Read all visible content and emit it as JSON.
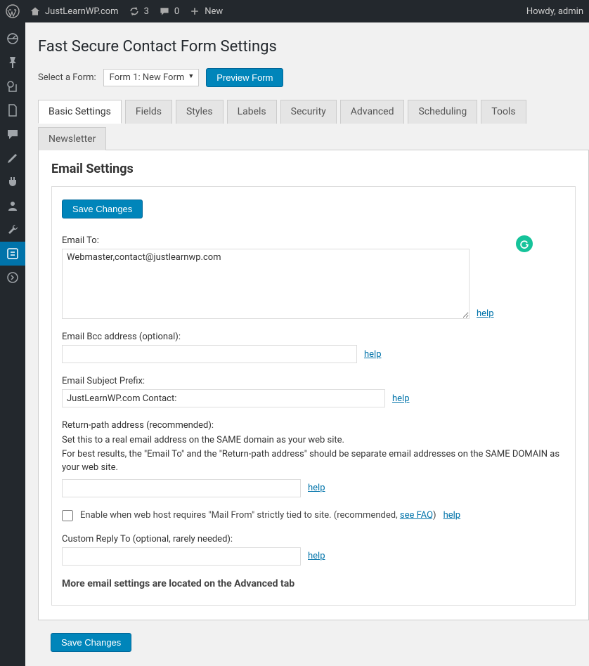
{
  "admin_bar": {
    "site_name": "JustLearnWP.com",
    "updates_count": "3",
    "comments_count": "0",
    "new_label": "New",
    "howdy": "Howdy, admin"
  },
  "page": {
    "title": "Fast Secure Contact Form Settings",
    "select_form_label": "Select a Form:",
    "selected_form": "Form 1: New Form",
    "preview_button": "Preview Form"
  },
  "tabs": [
    {
      "label": "Basic Settings",
      "active": true
    },
    {
      "label": "Fields",
      "active": false
    },
    {
      "label": "Styles",
      "active": false
    },
    {
      "label": "Labels",
      "active": false
    },
    {
      "label": "Security",
      "active": false
    },
    {
      "label": "Advanced",
      "active": false
    },
    {
      "label": "Scheduling",
      "active": false
    },
    {
      "label": "Tools",
      "active": false
    },
    {
      "label": "Newsletter",
      "active": false
    }
  ],
  "email_settings": {
    "section_title": "Email Settings",
    "save_button": "Save Changes",
    "help_label": "help",
    "email_to": {
      "label": "Email To:",
      "value": "Webmaster,contact@justlearnwp.com"
    },
    "email_bcc": {
      "label": "Email Bcc address (optional):",
      "value": ""
    },
    "subject_prefix": {
      "label": "Email Subject Prefix:",
      "value": "JustLearnWP.com Contact:"
    },
    "return_path": {
      "label": "Return-path address (recommended):",
      "hint1": "Set this to a real email address on the SAME domain as your web site.",
      "hint2": "For best results, the \"Email To\" and the \"Return-path address\" should be separate email addresses on the SAME DOMAIN as your web site.",
      "value": ""
    },
    "mail_from_checkbox": {
      "text_before": "Enable when web host requires \"Mail From\" strictly tied to site. (recommended, ",
      "faq_link": "see FAQ",
      "text_after": ")",
      "checked": false
    },
    "custom_reply_to": {
      "label": "Custom Reply To (optional, rarely needed):",
      "value": ""
    },
    "more_note": "More email settings are located on the Advanced tab"
  }
}
